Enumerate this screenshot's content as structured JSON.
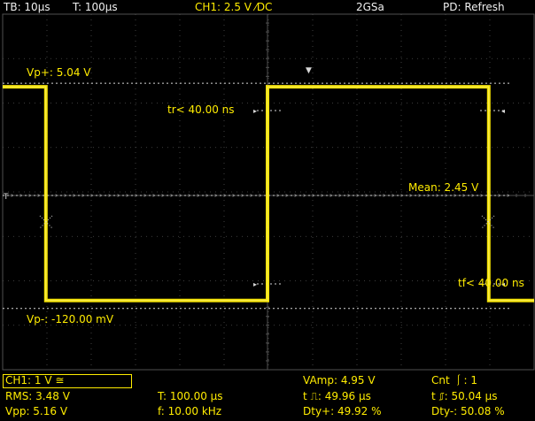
{
  "top_bar": {
    "timebase": "TB: 10µs",
    "period": "T: 100µs",
    "channel": "CH1: 2.5 V ⁄DC",
    "sample_rate": "2GSa",
    "peak_detect": "PD: Refresh"
  },
  "waveform": {
    "high_level_v": 5.04,
    "low_level_v": -0.12,
    "period_us": 100,
    "duty_percent": 49.96,
    "rise_ns": 40,
    "fall_ns": 40,
    "volts_per_div": 1,
    "time_per_div_us": 10,
    "color": "#ffec00"
  },
  "cursor_labels": {
    "vp_plus": "Vp+: 5.04 V",
    "vp_minus": "Vp-: -120.00 mV",
    "mean": "Mean: 2.45 V",
    "tr": "tr< 40.00 ns",
    "tf": "tf< 40.00 ns"
  },
  "markers": {
    "trigger_level": "T",
    "trigger_position": "▼"
  },
  "measurements": {
    "ch1_setting": "CH1: 1 V ≅",
    "rms": "RMS: 3.48 V",
    "vpp": "Vpp: 5.16 V",
    "t": "T: 100.00 µs",
    "f": "f: 10.00 kHz",
    "vamp": "VAmp: 4.95 V",
    "t_pos": "t ⎍: 49.96 µs",
    "dty_pos": "Dty+: 49.92 %",
    "cnt": "Cnt ⎰: 1",
    "t_neg": "t ⎎: 50.04 µs",
    "dty_neg": "Dty-: 50.08 %"
  },
  "colors": {
    "background": "#000000",
    "grid": "#505050",
    "trace": "#ffec00",
    "text": "#f0f0f0"
  }
}
